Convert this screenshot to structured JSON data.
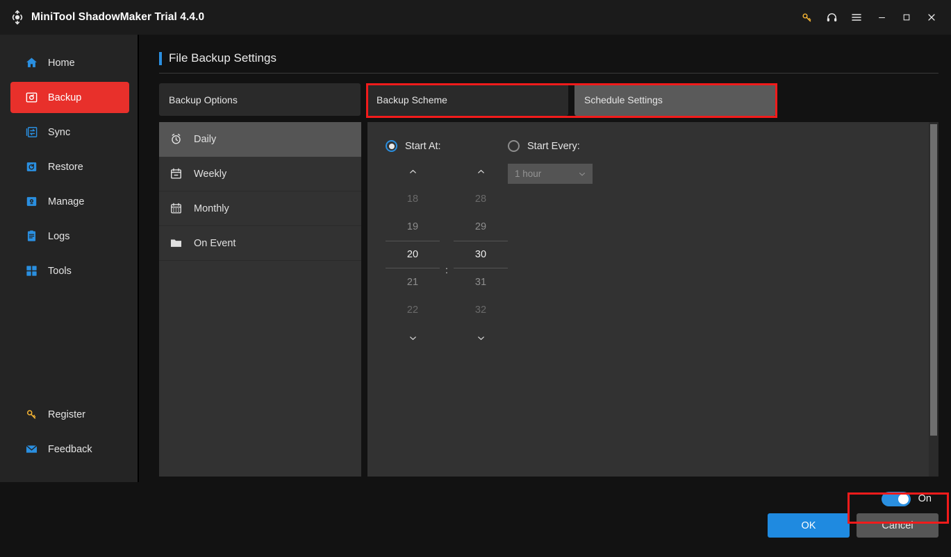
{
  "window": {
    "title": "MiniTool ShadowMaker Trial 4.4.0",
    "logo_icon": "shadowmaker-logo-icon",
    "controls": [
      {
        "name": "key-icon",
        "label": "Register"
      },
      {
        "name": "headset-icon",
        "label": "Support"
      },
      {
        "name": "menu-icon",
        "label": "Menu"
      },
      {
        "name": "minimize-icon",
        "label": "Minimize"
      },
      {
        "name": "maximize-icon",
        "label": "Maximize"
      },
      {
        "name": "close-icon",
        "label": "Close"
      }
    ]
  },
  "sidebar": {
    "items": [
      {
        "label": "Home",
        "icon": "home-icon",
        "active": false
      },
      {
        "label": "Backup",
        "icon": "backup-icon",
        "active": true
      },
      {
        "label": "Sync",
        "icon": "sync-icon",
        "active": false
      },
      {
        "label": "Restore",
        "icon": "restore-icon",
        "active": false
      },
      {
        "label": "Manage",
        "icon": "manage-icon",
        "active": false
      },
      {
        "label": "Logs",
        "icon": "logs-icon",
        "active": false
      },
      {
        "label": "Tools",
        "icon": "tools-icon",
        "active": false
      }
    ],
    "bottom_items": [
      {
        "label": "Register",
        "icon": "key-icon"
      },
      {
        "label": "Feedback",
        "icon": "mail-icon"
      }
    ]
  },
  "page": {
    "title": "File Backup Settings",
    "accent_color": "#2a8fe0"
  },
  "tabs": [
    {
      "label": "Backup Options",
      "active": false
    },
    {
      "label": "Backup Scheme",
      "active": false
    },
    {
      "label": "Schedule Settings",
      "active": true
    }
  ],
  "schedule_types": [
    {
      "label": "Daily",
      "icon": "alarm-clock-icon",
      "active": true
    },
    {
      "label": "Weekly",
      "icon": "calendar-icon",
      "active": false
    },
    {
      "label": "Monthly",
      "icon": "calendar-grid-icon",
      "active": false
    },
    {
      "label": "On Event",
      "icon": "folder-icon",
      "active": false
    }
  ],
  "schedule_panel": {
    "start_at": {
      "label": "Start At:",
      "selected": true,
      "hours": [
        "18",
        "19",
        "20",
        "21",
        "22"
      ],
      "minutes": [
        "28",
        "29",
        "30",
        "31",
        "32"
      ],
      "selected_hour": "20",
      "selected_minute": "30",
      "separator": ":",
      "up_icon": "chevron-up-icon",
      "down_icon": "chevron-down-icon"
    },
    "start_every": {
      "label": "Start Every:",
      "selected": false,
      "interval_value": "1 hour",
      "dropdown_icon": "chevron-down-icon",
      "disabled": true
    }
  },
  "footer": {
    "toggle": {
      "label": "On",
      "state": "on",
      "color": "#2a8fe0"
    },
    "ok_label": "OK",
    "cancel_label": "Cancel"
  },
  "annotations": {
    "color": "#f21b1b",
    "boxes": [
      {
        "name": "tabs-highlight",
        "targets": "Backup Scheme / Schedule Settings tabs"
      },
      {
        "name": "toggle-highlight",
        "targets": "schedule On toggle"
      }
    ]
  }
}
